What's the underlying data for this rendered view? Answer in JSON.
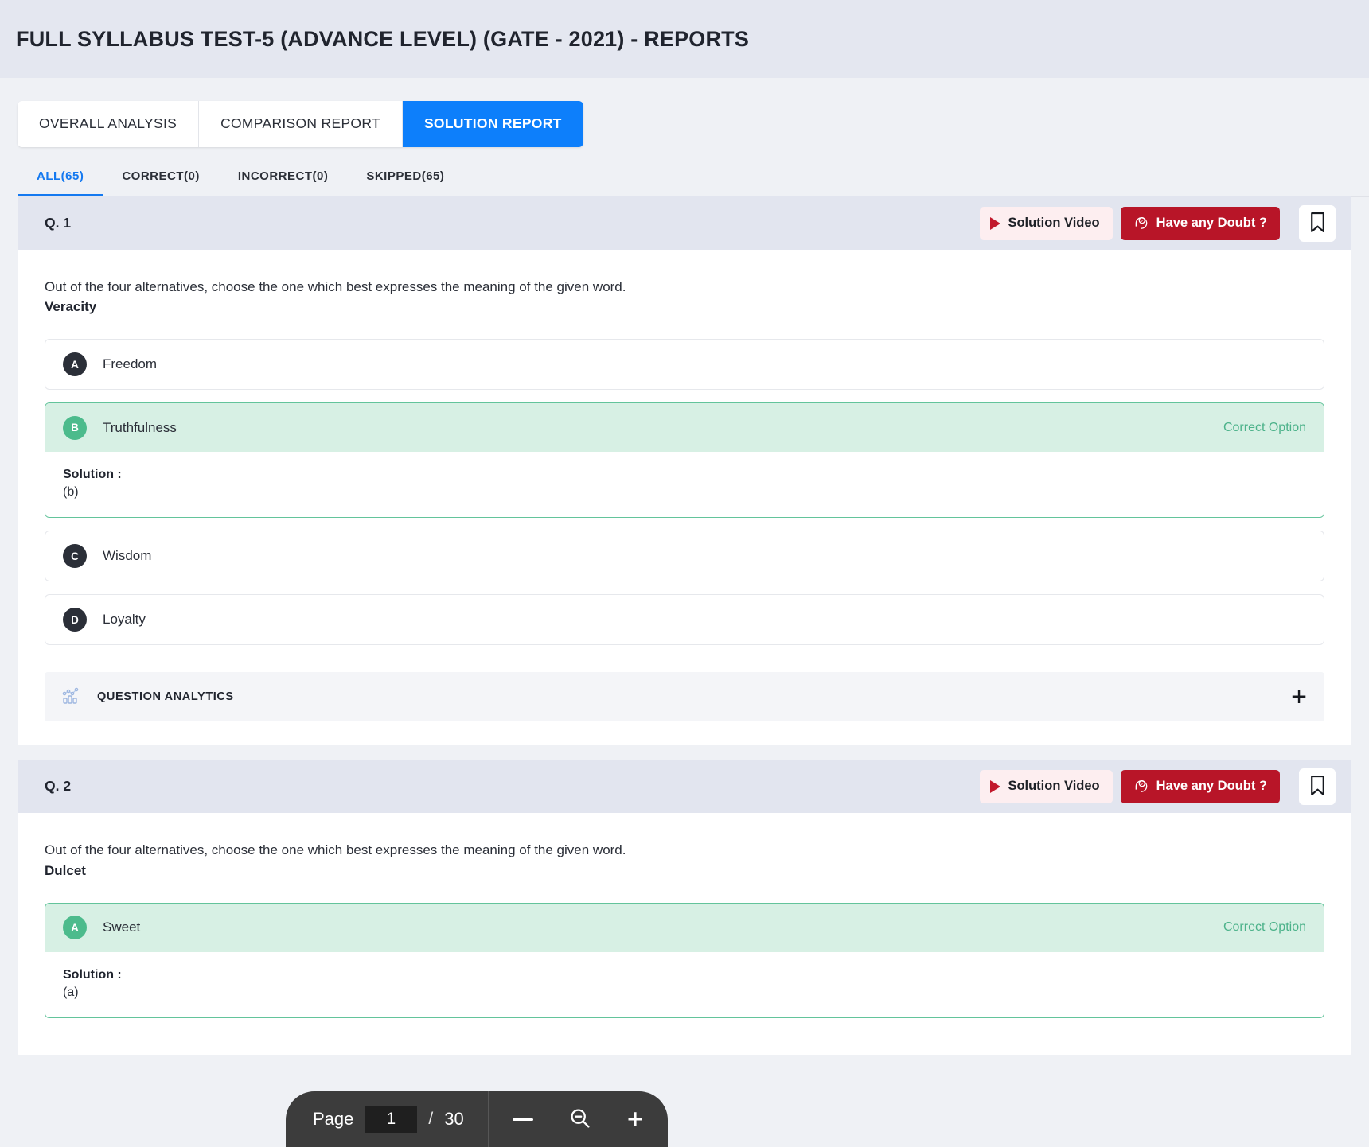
{
  "header": {
    "title": "FULL SYLLABUS TEST-5 (ADVANCE LEVEL) (GATE - 2021) - REPORTS"
  },
  "report_tabs": [
    {
      "label": "OVERALL ANALYSIS",
      "active": false
    },
    {
      "label": "COMPARISON REPORT",
      "active": false
    },
    {
      "label": "SOLUTION REPORT",
      "active": true
    }
  ],
  "filter_tabs": [
    {
      "label": "ALL(65)",
      "active": true
    },
    {
      "label": "CORRECT(0)",
      "active": false
    },
    {
      "label": "INCORRECT(0)",
      "active": false
    },
    {
      "label": "SKIPPED(65)",
      "active": false
    }
  ],
  "actions": {
    "solution_video": "Solution Video",
    "have_doubt": "Have any Doubt ?",
    "bookmark_icon": "bookmark-icon",
    "play_icon": "play-icon",
    "doubt_icon": "question-head-icon"
  },
  "analytics": {
    "label": "QUESTION ANALYTICS",
    "icon": "bar-chart-icon",
    "expand": "+"
  },
  "labels": {
    "correct_option": "Correct Option",
    "solution": "Solution :"
  },
  "questions": [
    {
      "number": "Q. 1",
      "prompt": "Out of the four alternatives, choose the one which best expresses the meaning of the given word.",
      "word": "Veracity",
      "options": [
        {
          "badge": "A",
          "text": "Freedom",
          "correct": false
        },
        {
          "badge": "B",
          "text": "Truthfulness",
          "correct": true,
          "solution": "(b)"
        },
        {
          "badge": "C",
          "text": "Wisdom",
          "correct": false
        },
        {
          "badge": "D",
          "text": "Loyalty",
          "correct": false
        }
      ]
    },
    {
      "number": "Q. 2",
      "prompt": "Out of the four alternatives, choose the one which best expresses the meaning of the given word.",
      "word": "Dulcet",
      "options": [
        {
          "badge": "A",
          "text": "Sweet",
          "correct": true,
          "solution": "(a)"
        }
      ]
    }
  ],
  "pager": {
    "page_word": "Page",
    "current_page": "1",
    "separator": "/",
    "total_pages": "30",
    "zoom_out_icon": "minus-icon",
    "magnifier_icon": "magnifier-minus-icon",
    "zoom_in_icon": "plus-icon"
  },
  "colors": {
    "accent_blue": "#0d7ffb",
    "correct_green": "#4cbb8c",
    "doubt_red": "#b81528",
    "header_bg": "#e4e7f0"
  }
}
